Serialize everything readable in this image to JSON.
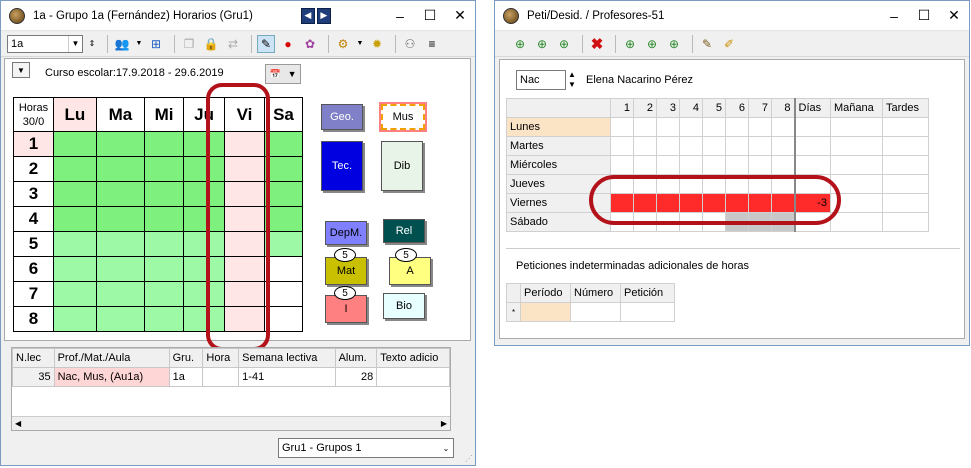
{
  "left_window": {
    "title": "1a - Grupo 1a (Fernández)  Horarios  (Gru1)",
    "class_combo": "1a",
    "school_year": "Curso escolar:17.9.2018 - 29.6.2019",
    "header_hours_top": "Horas",
    "header_hours_bottom": "30/0",
    "days": [
      "Lu",
      "Ma",
      "Mi",
      "Ju",
      "Vi",
      "Sa"
    ],
    "hours": [
      "1",
      "2",
      "3",
      "4",
      "5",
      "6",
      "7",
      "8"
    ],
    "chips": [
      {
        "label": "Geo.",
        "color": "#8080c8"
      },
      {
        "label": "Mus",
        "color": "#ffffff"
      },
      {
        "label": "Tec.",
        "color": "#0000e0"
      },
      {
        "label": "Dib",
        "color": "#e8f4e8"
      },
      {
        "label": "DepM.",
        "color": "#8080ff"
      },
      {
        "label": "Rel",
        "color": "#005050"
      },
      {
        "label": "Mat",
        "color": "#c8c000",
        "badge": "5"
      },
      {
        "label": "A",
        "color": "#ffff80",
        "badge": "5"
      },
      {
        "label": "I",
        "color": "#ff8080",
        "badge": "5"
      },
      {
        "label": "Bio",
        "color": "#e8ffff"
      }
    ],
    "lesson_table": {
      "headers": [
        "N.lec",
        "Prof./Mat./Aula",
        "Gru.",
        "Hora",
        "Semana lectiva",
        "Alum.",
        "Texto adicio"
      ],
      "row": [
        "35",
        "Nac, Mus, (Au1a)",
        "1a",
        "",
        "1-41",
        "28",
        ""
      ]
    },
    "group_combo": "Gru1 - Grupos 1"
  },
  "right_window": {
    "title": "Peti/Desid. / Profesores-51",
    "teacher_code": "Nac",
    "teacher_name": "Elena Nacarino Pérez",
    "col_headers": [
      "1",
      "2",
      "3",
      "4",
      "5",
      "6",
      "7",
      "8",
      "Días",
      "Mañana",
      "Tardes"
    ],
    "rows": [
      "Lunes",
      "Martes",
      "Miércoles",
      "Jueves",
      "Viernes",
      "Sábado"
    ],
    "friday_value": "-3",
    "additional_label": "Peticiones indeterminadas adicionales de horas",
    "pet_headers": [
      "Período",
      "Número",
      "Petición"
    ],
    "pet_marker": "*"
  },
  "colors": {
    "highlight_ring": "#b3121b",
    "friday_red": "#ff2a2a",
    "monday_orange": "#fbe3c6"
  }
}
